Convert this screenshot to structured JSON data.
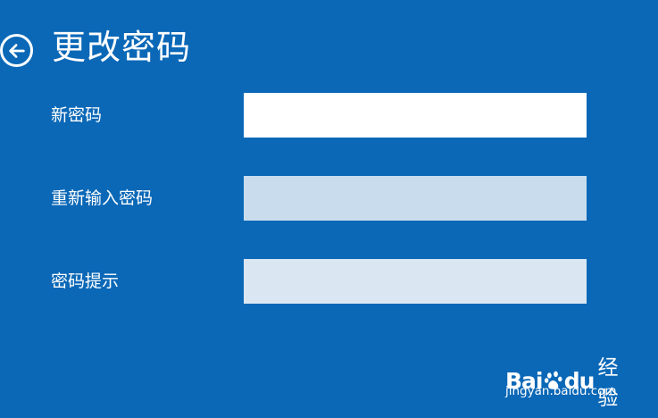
{
  "header": {
    "title": "更改密码",
    "back_icon": "back-arrow-circle-icon"
  },
  "form": {
    "new_password": {
      "label": "新密码",
      "value": ""
    },
    "confirm_password": {
      "label": "重新输入密码",
      "value": ""
    },
    "password_hint": {
      "label": "密码提示",
      "value": ""
    }
  },
  "watermark": {
    "logo_text_bai": "Bai",
    "logo_text_du": "du",
    "logo_text_jingyan": "经验",
    "url": "jingyan.baidu.com"
  },
  "colors": {
    "background": "#0b68b7",
    "new_password_field": "#ffffff",
    "confirm_password_field": "#c8dcee",
    "password_hint_field": "#dae7f2"
  }
}
